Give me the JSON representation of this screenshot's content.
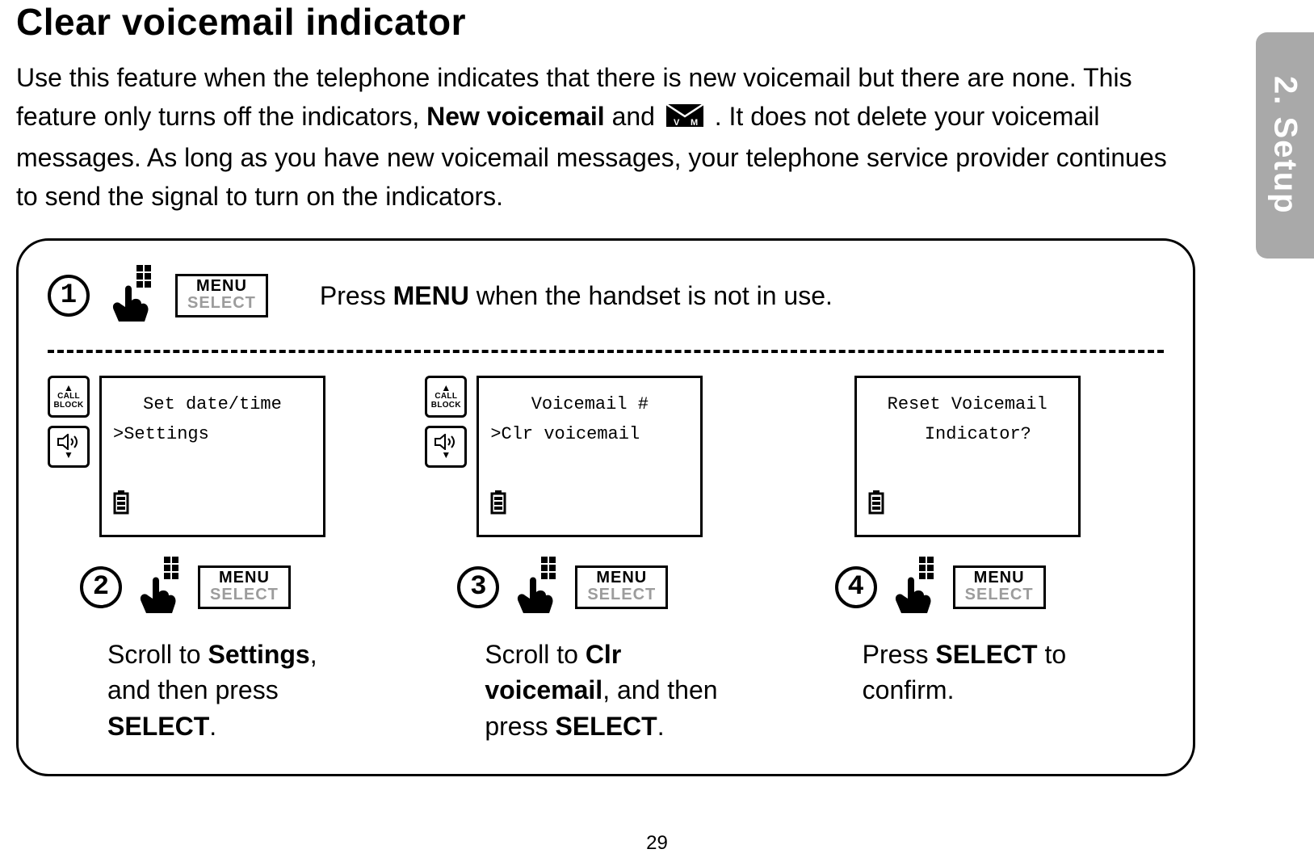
{
  "sideTab": "2. Setup",
  "heading": "Clear voicemail indicator",
  "intro": {
    "part1": "Use this feature when the telephone indicates that there is new voicemail but there are none. This feature only turns off the indicators, ",
    "bold1": "New voicemail",
    "part2": " and ",
    "part3": ". It does not delete your voicemail messages. As long as you have new voicemail messages, your telephone service provider continues to send the signal to turn on the indicators."
  },
  "menuBtn": {
    "top": "MENU",
    "bot": "SELECT"
  },
  "navUp": {
    "line1": "CALL",
    "line2": "BLOCK"
  },
  "step1": {
    "num": "1",
    "textA": "Press ",
    "textBold": "MENU",
    "textB": " when the handset is not in use."
  },
  "step2": {
    "num": "2",
    "screen": {
      "line1": "Set date/time",
      "line2": ">Settings"
    },
    "textA": "Scroll to ",
    "bold1": "Settings",
    "textB": ", and then press ",
    "bold2": "SELECT",
    "textC": "."
  },
  "step3": {
    "num": "3",
    "screen": {
      "line1": "Voicemail #",
      "line2": ">Clr voicemail"
    },
    "textA": "Scroll to ",
    "bold1": "Clr voicemail",
    "textB": ", and then press ",
    "bold2": "SELECT",
    "textC": "."
  },
  "step4": {
    "num": "4",
    "screen": {
      "line1": "Reset Voicemail",
      "line2": "  Indicator?"
    },
    "textA": "Press ",
    "bold1": "SELECT",
    "textB": " to confirm."
  },
  "pageNum": "29"
}
